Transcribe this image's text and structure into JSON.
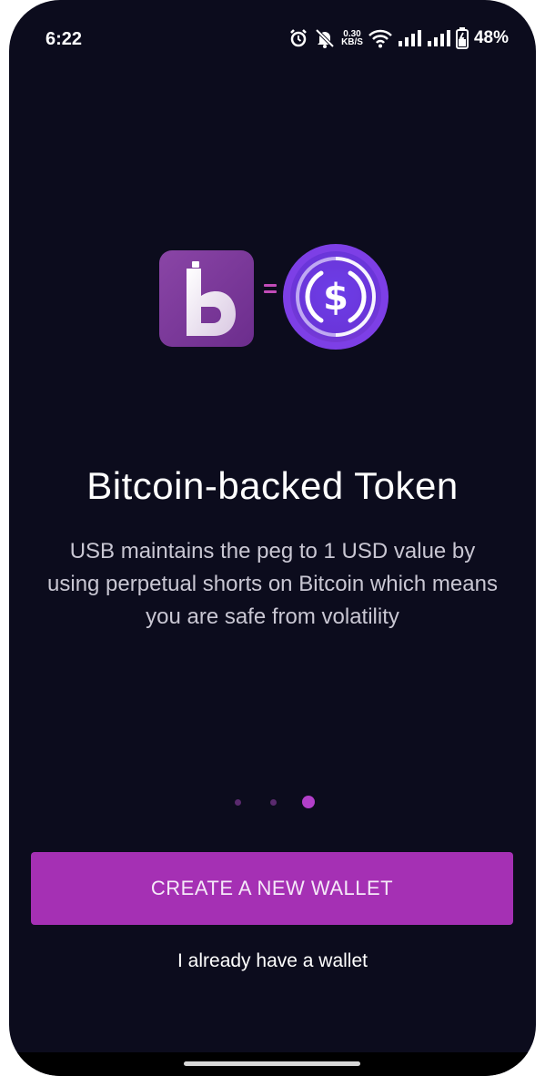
{
  "status_bar": {
    "time": "6:22",
    "net_speed_value": "0.30",
    "net_speed_unit": "KB/S",
    "battery_percent": "48%",
    "icons": [
      "alarm-icon",
      "mute-icon",
      "wifi-icon",
      "signal-icon",
      "signal-icon",
      "battery-charging-icon"
    ]
  },
  "hero": {
    "left_logo": "b-token-logo-icon",
    "separator": "=",
    "right_logo": "usdc-coin-icon"
  },
  "content": {
    "title": "Bitcoin-backed Token",
    "description": "USB maintains the peg to 1 USD value by using perpetual shorts on Bitcoin which means you are safe from volatility"
  },
  "pager": {
    "total": 3,
    "active_index": 2
  },
  "actions": {
    "create_label": "CREATE A NEW WALLET",
    "existing_label": "I already have a wallet"
  },
  "colors": {
    "background": "#0c0c1d",
    "accent": "#a530b4",
    "usdc_purple": "#6a39e0"
  }
}
